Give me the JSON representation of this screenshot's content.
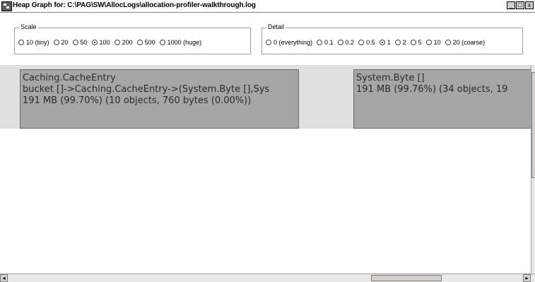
{
  "window": {
    "title": "Heap Graph for: C:\\PAG\\SW\\AllocLogs\\allocation-profiler-walkthrough.log",
    "minimize_glyph": "_",
    "maximize_glyph": "□",
    "close_glyph": "x"
  },
  "scale": {
    "label": "Scale",
    "options": [
      "10 (tiny)",
      "20",
      "50",
      "100",
      "200",
      "500",
      "1000 (huge)"
    ],
    "selected": "100"
  },
  "detail": {
    "label": "Detail",
    "options": [
      "0 (everything)",
      "0.1",
      "0.2",
      "0.5",
      "1",
      "2",
      "5",
      "10",
      "20 (coarse)"
    ],
    "selected": "1"
  },
  "nodes": [
    {
      "line1": "Caching.CacheEntry",
      "line2": "bucket []->Caching.CacheEntry->(System.Byte [],Sys",
      "line3": " 191 MB    (99.70%)  (10 objects,  760 bytes (0.00%))"
    },
    {
      "line1": "System.Byte []",
      "line2": " 191 MB    (99.76%)  (34 objects,  19",
      "line3": ""
    }
  ],
  "scrollbars": {
    "left_arrow": "◂",
    "right_arrow": "▸",
    "up_arrow": "▴"
  },
  "colors": {
    "node_fill": "#a6a6a6",
    "band": "#e0e0e0"
  }
}
